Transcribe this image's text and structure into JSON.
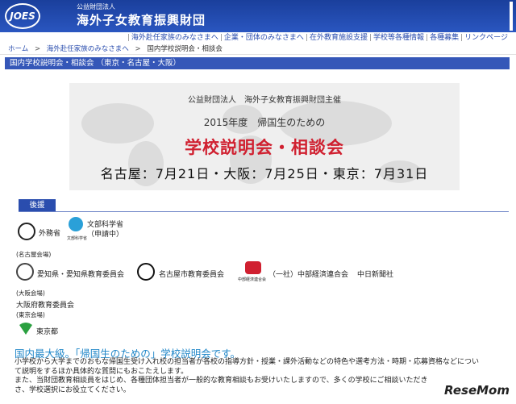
{
  "header": {
    "logo_text": "JOES",
    "org_kicker": "公益財団法人",
    "org_name": "海外子女教育振興財団"
  },
  "topnav": {
    "items": [
      "海外赴任家族のみなさまへ",
      "企業・団体のみなさまへ",
      "在外教育施設支援",
      "学校等各種情報",
      "各種募集",
      "リンクページ"
    ]
  },
  "breadcrumb": {
    "home": "ホーム",
    "sep": ">",
    "level1": "海外赴任家族のみなさまへ",
    "current": "国内学校説明会・相談会"
  },
  "section_title": "国内学校説明会・相談会 （東京・名古屋・大阪）",
  "banner": {
    "sponsor": "公益財団法人　海外子女教育振興財団主催",
    "year": "2015年度　帰国生のための",
    "event": "学校説明会・相談会",
    "dates": "名古屋：7月21日・大阪：7月25日・東京：7月31日"
  },
  "support": {
    "tab": "後援",
    "national": [
      "外務省",
      "文部科学省",
      "（申請中）"
    ],
    "mext_small": "文部科学省",
    "nagoya_label": "(名古屋会場)",
    "nagoya": [
      "愛知県・愛知県教育委員会",
      "名古屋市教育委員会",
      "中部経済連合会",
      "（一社）中部経済連合会",
      "中日新聞社"
    ],
    "osaka_label": "(大阪会場)",
    "osaka": [
      "大阪府教育委員会"
    ],
    "tokyo_label": "(東京会場)",
    "tokyo": [
      "東京都"
    ]
  },
  "intro": {
    "heading": "国内最大級。「帰国生のための」学校説明会です。",
    "lines": [
      "小学校から大学までのおもな帰国生受け入れ校の担当者が各校の指導方針・授業・課外活動などの特色や選考方法・時期・応募資格などについ",
      "て説明をするほか具体的な質問にもおこたえします。",
      "また、当財団教育相談員をはじめ、各種団体担当者が一般的な教育相談もお受けいたしますので、多くの学校にご相談いただき",
      "さ、学校選択にお役立てください。"
    ]
  },
  "watermark": "ReseMom",
  "colors": {
    "header": "#2a4dae",
    "accent": "#d02030",
    "heading": "#1f86c8"
  }
}
